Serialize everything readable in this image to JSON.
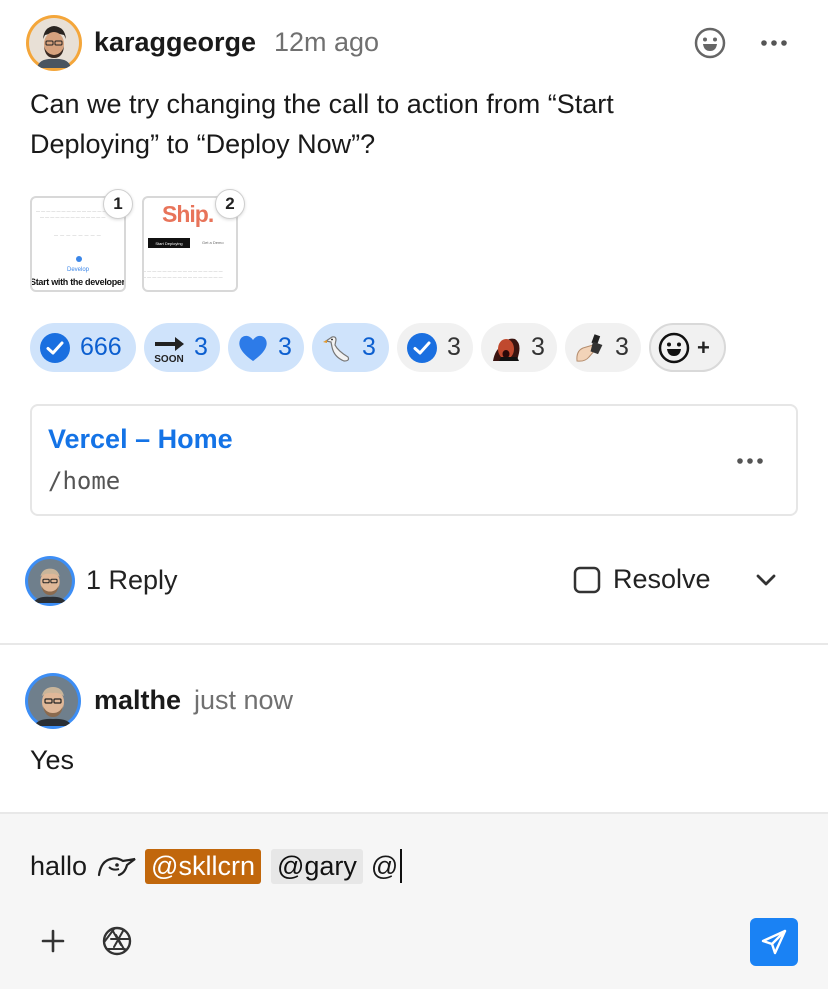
{
  "comment": {
    "author": "karaggeorge",
    "time": "12m ago",
    "body": "Can we try changing the call to action from “Start Deploying” to “Deploy Now”?",
    "attachments": [
      {
        "badge": "1",
        "caption": "Start with the developer",
        "sub_label": "Develop"
      },
      {
        "badge": "2",
        "brand": "Ship.",
        "button_label": "Start Deploying",
        "secondary_label": "Get a Demo"
      }
    ]
  },
  "reactions": [
    {
      "emoji": "check-mark-button",
      "count": "666",
      "active": true
    },
    {
      "emoji": "soon-arrow",
      "count": "3",
      "active": true
    },
    {
      "emoji": "blue-heart",
      "count": "3",
      "active": true
    },
    {
      "emoji": "goose",
      "count": "3",
      "active": true
    },
    {
      "emoji": "check-mark-button",
      "count": "3",
      "active": false
    },
    {
      "emoji": "screaming-face",
      "count": "3",
      "active": false
    },
    {
      "emoji": "nail-polish",
      "count": "3",
      "active": false
    }
  ],
  "add_reaction_label": "+",
  "link_card": {
    "title": "Vercel – Home",
    "path": "/home"
  },
  "thread": {
    "reply_count_label": "1 Reply",
    "resolve_label": "Resolve"
  },
  "reply": {
    "author": "malthe",
    "time": "just now",
    "body": "Yes"
  },
  "composer": {
    "text_before": "hallo",
    "mention_1": "@skllcrn",
    "mention_2": "@gary",
    "trailing": "@"
  },
  "colors": {
    "accent": "#1a82f4",
    "link": "#1473e6",
    "reaction_active_bg": "#cfe3fb",
    "mention_1_bg": "#c1670c",
    "mention_2_bg": "#e7e7e7",
    "author_ring": "#f4a63a",
    "reply_ring": "#3d8ef5"
  }
}
